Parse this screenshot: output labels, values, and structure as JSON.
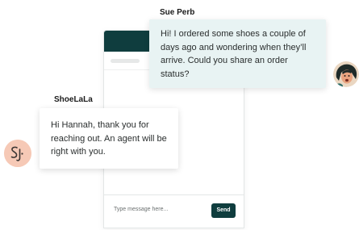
{
  "conversation": {
    "customer": {
      "name": "Sue Perb",
      "message": "Hi! I ordered some shoes a couple of days ago and wondering when they’ll arrive. Could you share an order status?"
    },
    "brand": {
      "name": "ShoeLaLa",
      "message": "Hi Hannah, thank you for reaching out. An agent will be right with you."
    }
  },
  "composer": {
    "placeholder": "Type message here...",
    "send_label": "Send"
  },
  "colors": {
    "header_teal": "#0f3d3e",
    "customer_bubble": "#e8f3f3",
    "brand_avatar_bg": "#f6c9b6"
  }
}
